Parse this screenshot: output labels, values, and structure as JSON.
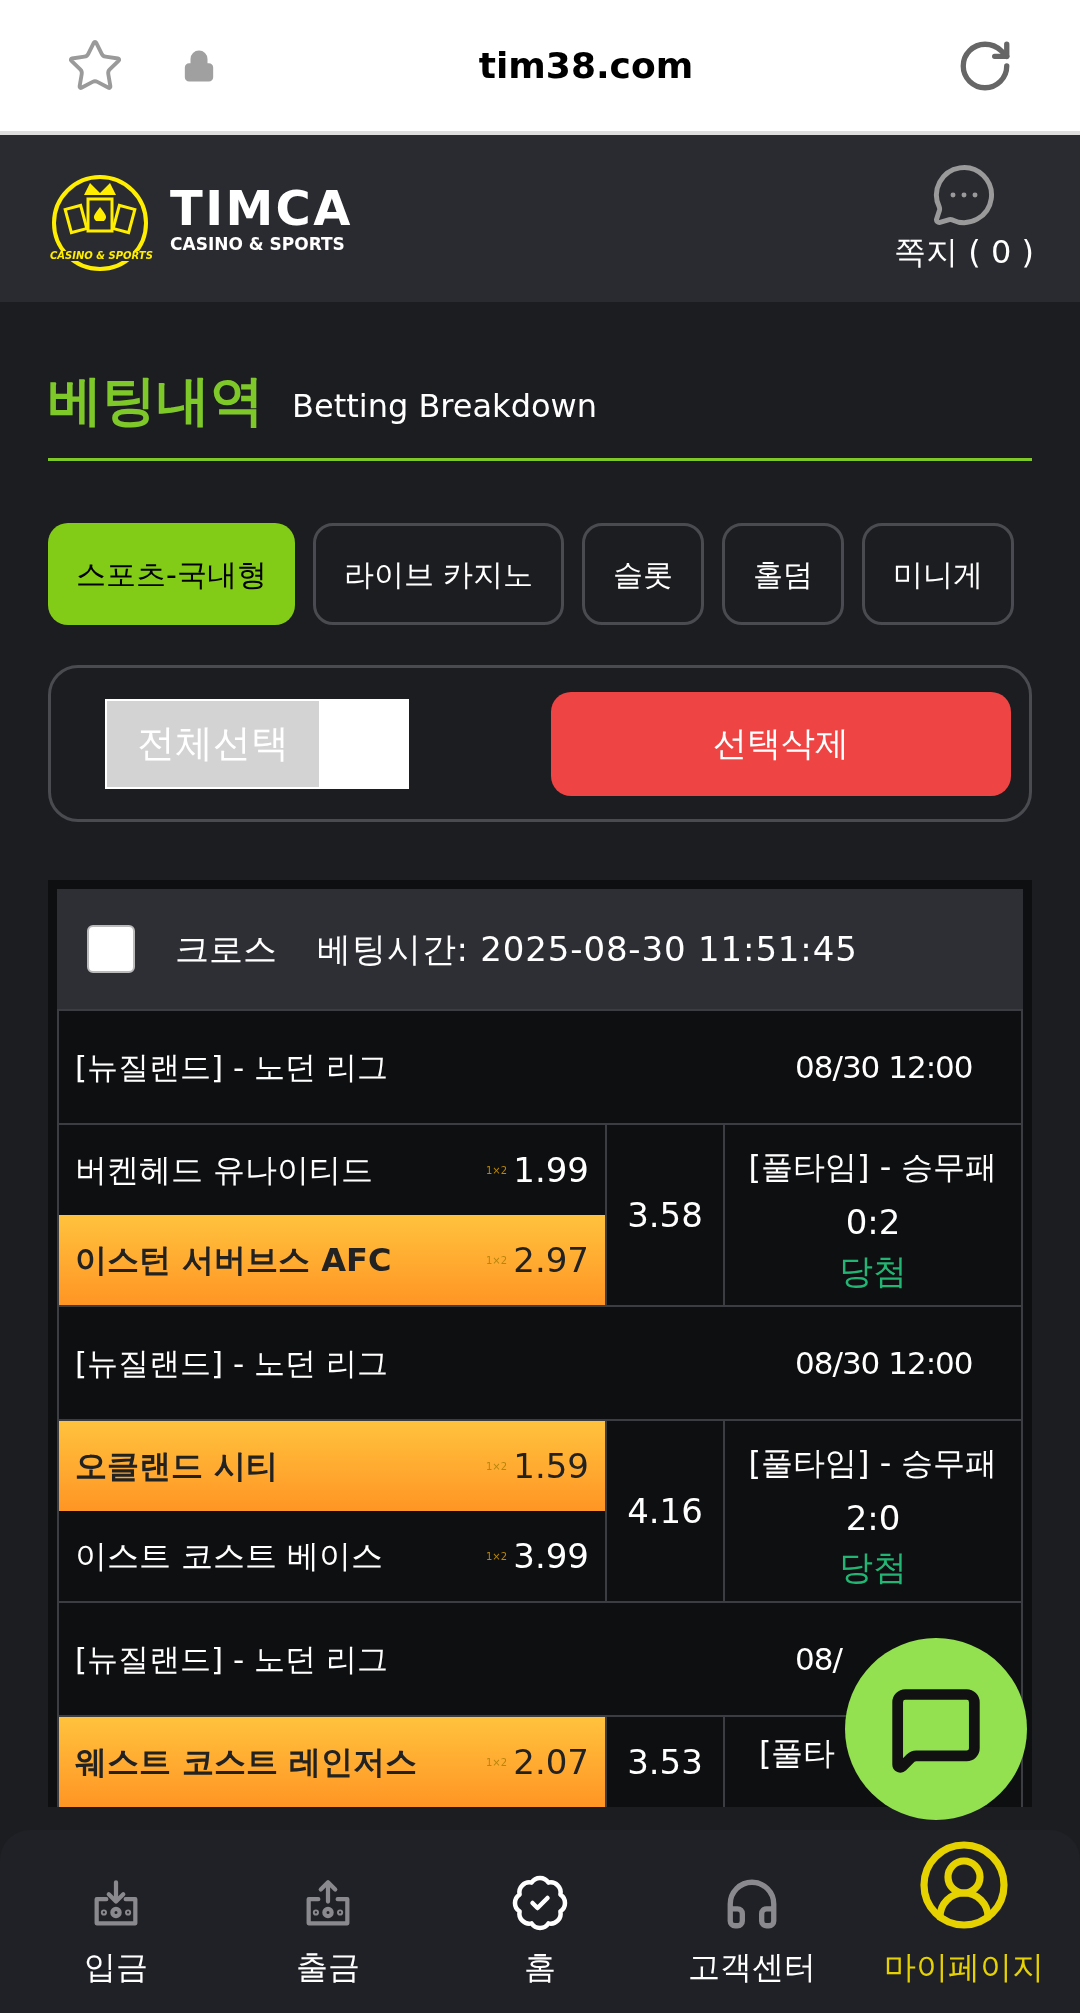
{
  "browser": {
    "url": "tim38.com"
  },
  "header": {
    "logo_title": "TIMCA",
    "logo_subtitle": "CASINO & SPORTS",
    "logo_badge": "CASINO & SPORTS",
    "messages": "쪽지 ( 0 )"
  },
  "page_title": {
    "korean": "베팅내역",
    "english": "Betting Breakdown"
  },
  "tabs": [
    {
      "label": "스포츠-국내형",
      "selected": true
    },
    {
      "label": "라이브 카지노",
      "selected": false
    },
    {
      "label": "슬롯",
      "selected": false
    },
    {
      "label": "홀덤",
      "selected": false
    },
    {
      "label": "미니게",
      "selected": false
    }
  ],
  "select_all": {
    "label": "전체선택",
    "checked": false
  },
  "delete_button": "선택삭제",
  "bet": {
    "checked": false,
    "type": "크로스",
    "time_label": "베팅시간: 2025-08-30 11:51:45",
    "games": [
      {
        "league": "[뉴질랜드] - 노던 리그",
        "time": "08/30 12:00",
        "total": "3.58",
        "market": "[풀타임] - 승무패",
        "score": "0:2",
        "result": "당첨",
        "teams": [
          {
            "name": "버켄헤드 유나이티드",
            "tag": "1×2",
            "odds": "1.99",
            "selected": false
          },
          {
            "name": "이스턴 서버브스 AFC",
            "tag": "1×2",
            "odds": "2.97",
            "selected": true
          }
        ]
      },
      {
        "league": "[뉴질랜드] - 노던 리그",
        "time": "08/30 12:00",
        "total": "4.16",
        "market": "[풀타임] - 승무패",
        "score": "2:0",
        "result": "당첨",
        "teams": [
          {
            "name": "오클랜드 시티",
            "tag": "1×2",
            "odds": "1.59",
            "selected": true
          },
          {
            "name": "이스트 코스트 베이스",
            "tag": "1×2",
            "odds": "3.99",
            "selected": false
          }
        ]
      },
      {
        "league": "[뉴질랜드] - 노던 리그",
        "time": "08/",
        "total": "3.53",
        "market": "[풀타",
        "teams": [
          {
            "name": "웨스트 코스트 레인저스",
            "tag": "1×2",
            "odds": "2.07",
            "selected": true
          }
        ]
      }
    ]
  },
  "nav": [
    {
      "label": "입금",
      "kind": "deposit",
      "selected": false
    },
    {
      "label": "출금",
      "kind": "withdraw",
      "selected": false
    },
    {
      "label": "홈",
      "kind": "home",
      "selected": false
    },
    {
      "label": "고객센터",
      "kind": "support",
      "selected": false
    },
    {
      "label": "마이페이지",
      "kind": "mypage",
      "selected": true
    }
  ]
}
